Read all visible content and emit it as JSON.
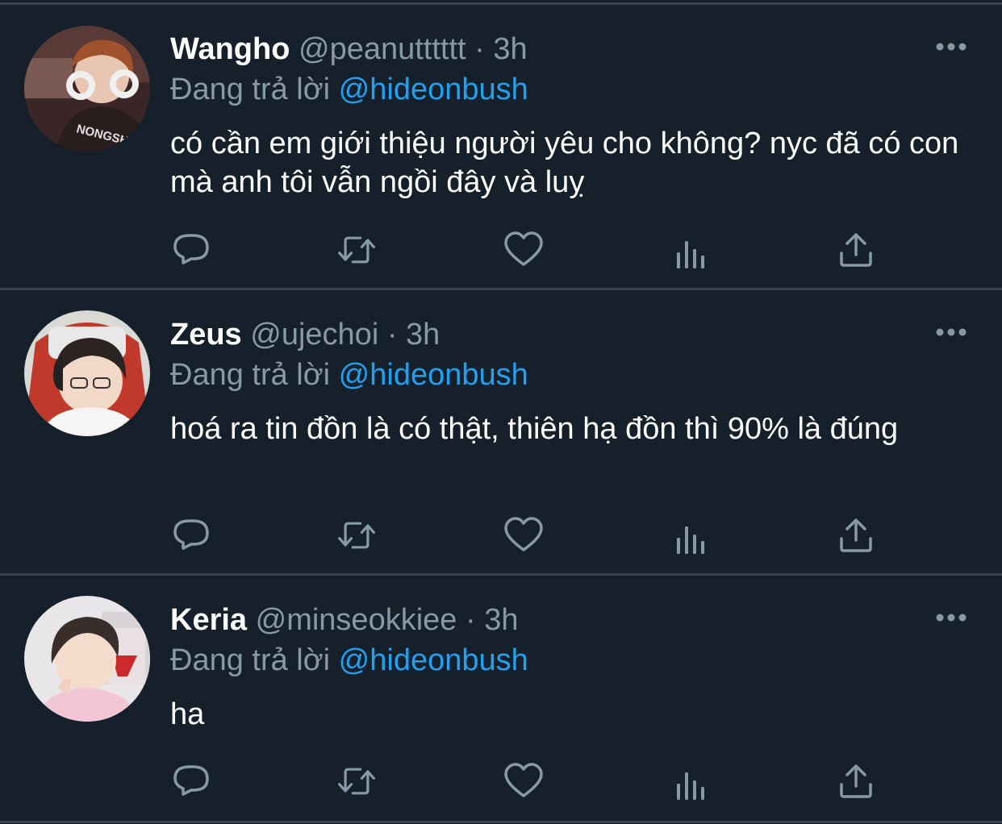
{
  "colors": {
    "background": "#15202b",
    "divider": "#38444d",
    "secondary_text": "#8899a6",
    "mention": "#1da1f2",
    "primary_text": "#ffffff"
  },
  "separator": "·",
  "tweets": [
    {
      "name": "Wangho",
      "handle": "@peanutttttt",
      "time": "3h",
      "reply_prefix": "Đang trả lời",
      "reply_to": "@hideonbush",
      "text": "có cần em giới thiệu người yêu cho không? nyc đã có con mà anh tôi vẫn ngồi đây và luỵ",
      "avatar_text": "NONGSHIM",
      "actions": [
        "reply-icon",
        "retweet-icon",
        "like-icon",
        "analytics-icon",
        "share-icon"
      ]
    },
    {
      "name": "Zeus",
      "handle": "@ujechoi",
      "time": "3h",
      "reply_prefix": "Đang trả lời",
      "reply_to": "@hideonbush",
      "text": "hoá ra tin đồn là có thật, thiên hạ đồn thì 90% là đúng",
      "avatar_text": "",
      "actions": [
        "reply-icon",
        "retweet-icon",
        "like-icon",
        "analytics-icon",
        "share-icon"
      ]
    },
    {
      "name": "Keria",
      "handle": "@minseokkiee",
      "time": "3h",
      "reply_prefix": "Đang trả lời",
      "reply_to": "@hideonbush",
      "text": "ha",
      "avatar_text": "",
      "actions": [
        "reply-icon",
        "retweet-icon",
        "like-icon",
        "analytics-icon",
        "share-icon"
      ]
    }
  ]
}
